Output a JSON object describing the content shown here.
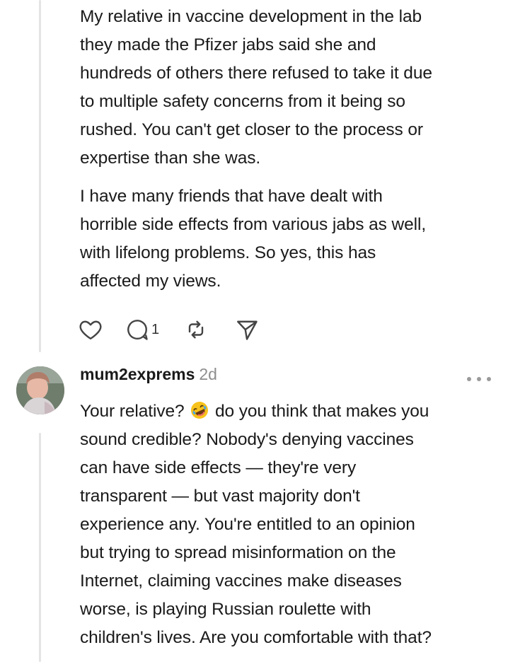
{
  "comment1": {
    "paragraphs": [
      "My relative in vaccine development in the lab\nthey made the Pfizer jabs said she and\nhundreds of others there refused to take it due\nto multiple safety concerns from it being so\nrushed. You can't get closer to the process or\nexpertise than she was.",
      "I have many friends that have dealt with\nhorrible side effects from various jabs as well,\nwith lifelong problems. So yes, this has\naffected my views."
    ],
    "actions": {
      "like_icon": "heart-icon",
      "reply_icon": "comment-bubble-icon",
      "reply_count": "1",
      "restack_icon": "restack-arrows-icon",
      "share_icon": "send-arrow-icon"
    }
  },
  "comment2": {
    "author": "mum2exprems",
    "time": "2d",
    "text_before_emoji": "Your relative?",
    "emoji": "rolling-on-floor-laughing-emoji",
    "text_after_emoji": "do you think that makes you\nsound credible? Nobody's denying vaccines\ncan have side effects — they're very\ntransparent — but vast majority don't\nexperience any. You're entitled to an opinion\nbut trying to spread misinformation on the\nInternet, claiming vaccines make diseases\nworse, is playing Russian roulette with\nchildren's lives. Are you comfortable with that?",
    "more_icon": "more-options-icon"
  },
  "colors": {
    "text": "#1a1a1a",
    "muted": "#8e8e8e",
    "thread_line": "#e4e4e4",
    "icon": "#444444"
  }
}
